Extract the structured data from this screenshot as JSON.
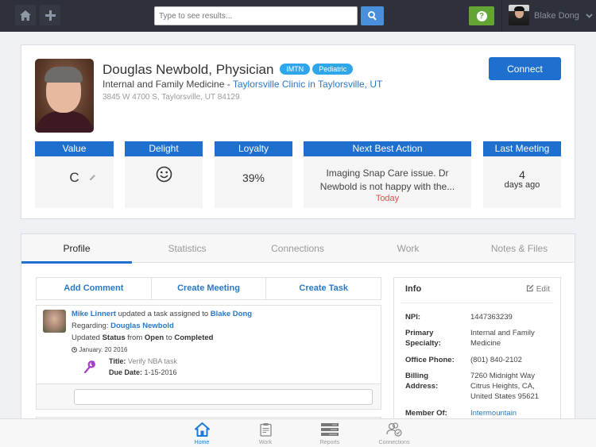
{
  "topbar": {
    "home_icon": "home-icon",
    "add_icon": "plus-icon",
    "search_placeholder": "Type to see results...",
    "search_icon": "search-icon",
    "help_label": "?",
    "user_name": "Blake Dong",
    "user_caret": "⌵"
  },
  "profile": {
    "name": "Douglas Newbold, Physician",
    "badges": [
      "IMTN",
      "Pediatric"
    ],
    "specialty": "Internal and Family Medicine - ",
    "clinic_link": "Taylorsville Clinic in Taylorsville, UT",
    "address": "3845 W 4700 S, Taylorsville, UT 84129",
    "connect_label": "Connect",
    "metrics": [
      {
        "header": "Value",
        "value": "C"
      },
      {
        "header": "Delight",
        "value": "☺"
      },
      {
        "header": "Loyalty",
        "value": "39%"
      },
      {
        "header": "Next Best Action",
        "value": "Imaging Snap Care issue. Dr Newbold is not happy with the...",
        "sub": "Today",
        "sub_color": "#e24c4c"
      },
      {
        "header": "Last Meeting",
        "value": "4",
        "sub": "days ago"
      }
    ]
  },
  "tabs": [
    {
      "label": "Profile",
      "active": true
    },
    {
      "label": "Statistics",
      "active": false
    },
    {
      "label": "Connections",
      "active": false
    },
    {
      "label": "Work",
      "active": false
    },
    {
      "label": "Notes & Files",
      "active": false
    }
  ],
  "actions": [
    "Add Comment",
    "Create Meeting",
    "Create Task"
  ],
  "feed": {
    "actor": "Mike Linnert",
    "verb": " updated a task assigned to ",
    "assignee": "Blake Dong",
    "regarding_label": "Regarding: ",
    "regarding": "Douglas Newbold",
    "update_prefix": "Updated ",
    "field": "Status",
    "from_word": " from ",
    "from_value": "Open",
    "to_word": " to ",
    "to_value": "Completed",
    "date": "January. 20 2016",
    "title_label": "Title:",
    "title_value": " Verify NBA task",
    "due_label": "Due Date:",
    "due_value": " 1-15-2016",
    "reply_placeholder": ""
  },
  "info": {
    "title": "Info",
    "edit_label": "Edit",
    "rows": [
      {
        "key": "NPI:",
        "value": "1447363239"
      },
      {
        "key": "Primary Specialty:",
        "value": "Internal and Family Medicine"
      },
      {
        "key": "Office Phone:",
        "value": "(801) 840-2102"
      },
      {
        "key": "Billing Address:",
        "value": "7260 Midnight Way Citrus Heights, CA, United States 95621"
      },
      {
        "key": "Member Of:",
        "value": "Intermountain",
        "link": true
      }
    ]
  },
  "bottom_nav": [
    {
      "label": "Home",
      "icon": "home-icon",
      "active": true
    },
    {
      "label": "Work",
      "icon": "clipboard-icon",
      "active": false
    },
    {
      "label": "Reports",
      "icon": "reports-icon",
      "active": false
    },
    {
      "label": "Connections",
      "icon": "connections-icon",
      "active": false
    }
  ],
  "colors": {
    "primary": "#1e6fce",
    "link": "#2b78c5",
    "badge": "#2fa6e9",
    "help": "#62a534",
    "alert": "#e24c4c",
    "topbar": "#2e3139"
  }
}
